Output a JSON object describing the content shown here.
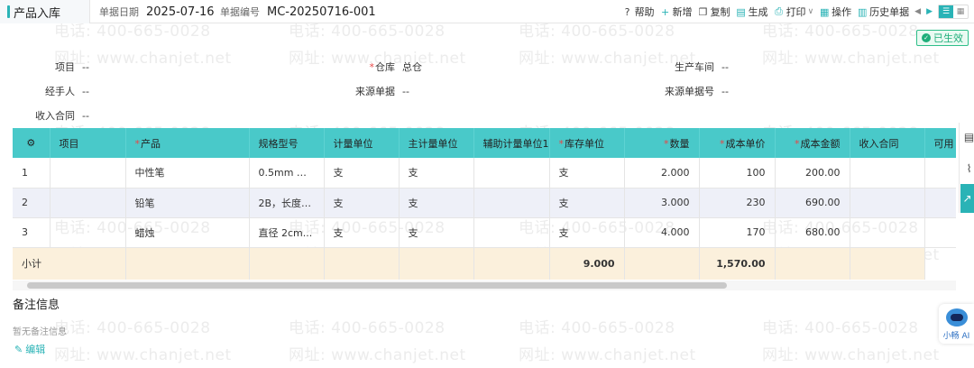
{
  "watermark": {
    "phone": "电话: 400-665-0028",
    "site": "网址: www.chanjet.net"
  },
  "tab": {
    "title": "产品入库"
  },
  "header": {
    "date_label": "单据日期",
    "date_value": "2025-07-16",
    "number_label": "单据编号",
    "number_value": "MC-20250716-001"
  },
  "toolbar": {
    "help": "帮助",
    "add": "新增",
    "copy": "复制",
    "generate": "生成",
    "print": "打印",
    "operate": "操作",
    "history": "历史单据"
  },
  "status_badge": "已生效",
  "fields": {
    "project_label": "项目",
    "project_value": "--",
    "warehouse_label": "仓库",
    "warehouse_value": "总仓",
    "workshop_label": "生产车间",
    "workshop_value": "--",
    "handler_label": "经手人",
    "handler_value": "--",
    "source_label": "来源单据",
    "source_value": "--",
    "source_no_label": "来源单据号",
    "source_no_value": "--",
    "contract_label": "收入合同",
    "contract_value": "--"
  },
  "table": {
    "columns": [
      "项目",
      "产品",
      "规格型号",
      "计量单位",
      "主计量单位",
      "辅助计量单位1 ...",
      "库存单位",
      "数量",
      "成本单价",
      "成本金额",
      "收入合同",
      "可用"
    ],
    "rows": [
      {
        "no": "1",
        "project": "",
        "product": "中性笔",
        "spec": "0.5mm 笔...",
        "unit": "支",
        "main_unit": "支",
        "aux_unit": "",
        "stock_unit": "支",
        "qty": "2.000",
        "price": "100",
        "amount": "200.00",
        "contract": "",
        "avail": ""
      },
      {
        "no": "2",
        "project": "",
        "product": "铅笔",
        "spec": "2B，长度 1...",
        "unit": "支",
        "main_unit": "支",
        "aux_unit": "",
        "stock_unit": "支",
        "qty": "3.000",
        "price": "230",
        "amount": "690.00",
        "contract": "",
        "avail": ""
      },
      {
        "no": "3",
        "project": "",
        "product": "蜡烛",
        "spec": "直径 2cm...",
        "unit": "支",
        "main_unit": "支",
        "aux_unit": "",
        "stock_unit": "支",
        "qty": "4.000",
        "price": "170",
        "amount": "680.00",
        "contract": "",
        "avail": ""
      }
    ],
    "summary": {
      "label": "小计",
      "qty": "9.000",
      "amount": "1,570.00"
    }
  },
  "notes": {
    "title": "备注信息",
    "empty": "暂无备注信息",
    "edit": "编辑"
  },
  "assistant": {
    "label": "小畅 AI"
  },
  "colors": {
    "accent": "#2ab3b6",
    "header_row": "#49c9c9",
    "summary_row": "#fbf0dc",
    "status_green": "#1fae7a"
  }
}
